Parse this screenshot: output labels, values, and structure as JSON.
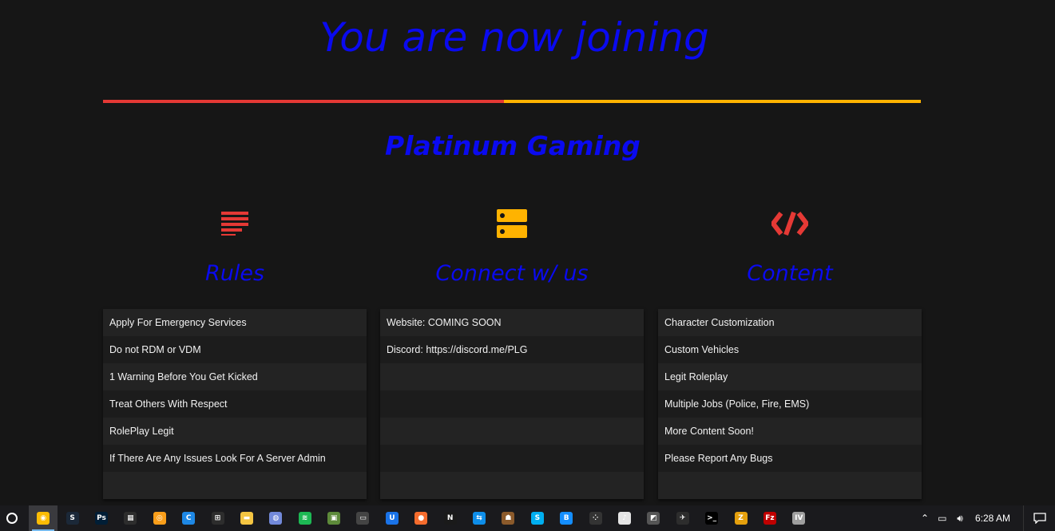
{
  "header": {
    "headline": "You are now joining",
    "server_name": "Platinum Gaming",
    "loading_progress_fraction": 0.49,
    "progress_colors": {
      "fill": "#e53935",
      "track": "#ffb300"
    }
  },
  "columns": [
    {
      "title": "Rules",
      "icon": "align-left-icon",
      "icon_color": "#e53935",
      "items": [
        "Apply For Emergency Services",
        "Do not RDM or VDM",
        "1 Warning Before You Get Kicked",
        "Treat Others With Respect",
        "RolePlay Legit",
        "If There Are Any Issues Look For A Server Admin",
        ""
      ]
    },
    {
      "title": "Connect w/ us",
      "icon": "server-icon",
      "icon_color": "#ffb300",
      "items": [
        "Website: COMING SOON",
        "Discord: https://discord.me/PLG",
        "",
        "",
        "",
        "",
        ""
      ]
    },
    {
      "title": "Content",
      "icon": "code-icon",
      "icon_color": "#e53935",
      "items": [
        "Character Customization",
        "Custom Vehicles",
        "Legit Roleplay",
        "Multiple Jobs (Police, Fire, EMS)",
        "More Content Soon!",
        "Please Report Any Bugs",
        ""
      ]
    }
  ],
  "taskbar": {
    "apps": [
      {
        "name": "chrome-icon",
        "active": true,
        "color": "#fbbc05",
        "glyph": "◉"
      },
      {
        "name": "steam-icon",
        "color": "#1b2838",
        "glyph": "S"
      },
      {
        "name": "photoshop-icon",
        "color": "#001e36",
        "glyph": "Ps"
      },
      {
        "name": "video-editor-icon",
        "color": "#2d2d2d",
        "glyph": "▦"
      },
      {
        "name": "overwatch-icon",
        "color": "#f99e1a",
        "glyph": "◎"
      },
      {
        "name": "ccleaner-icon",
        "color": "#1e88e5",
        "glyph": "C"
      },
      {
        "name": "store-icon",
        "color": "#2d2d2d",
        "glyph": "⊞"
      },
      {
        "name": "file-explorer-icon",
        "color": "#f4c542",
        "glyph": "▬"
      },
      {
        "name": "discord-icon",
        "color": "#7289da",
        "glyph": "◍"
      },
      {
        "name": "spotify-icon",
        "color": "#1db954",
        "glyph": "≋"
      },
      {
        "name": "minecraft-icon",
        "color": "#5d8a3a",
        "glyph": "▣"
      },
      {
        "name": "car-game-icon",
        "color": "#444444",
        "glyph": "▭"
      },
      {
        "name": "uplay-icon",
        "color": "#1a73e8",
        "glyph": "U"
      },
      {
        "name": "origin-icon",
        "color": "#f56c2d",
        "glyph": "●"
      },
      {
        "name": "netflix-icon",
        "color": "#1a1a1a",
        "glyph": "N"
      },
      {
        "name": "teamviewer-icon",
        "color": "#0e8ee9",
        "glyph": "⇆"
      },
      {
        "name": "game-character-icon",
        "color": "#8b5a2b",
        "glyph": "☗"
      },
      {
        "name": "skype-icon",
        "color": "#00aff0",
        "glyph": "S"
      },
      {
        "name": "battlenet-icon",
        "color": "#148eff",
        "glyph": "B"
      },
      {
        "name": "dots-app-icon",
        "color": "#333333",
        "glyph": "⁘"
      },
      {
        "name": "itunes-icon",
        "color": "#e5e5e5",
        "glyph": "♪"
      },
      {
        "name": "snipping-tool-icon",
        "color": "#555555",
        "glyph": "◩"
      },
      {
        "name": "airplane-app-icon",
        "color": "#2d2d2d",
        "glyph": "✈"
      },
      {
        "name": "terminal-icon",
        "color": "#000000",
        "glyph": ">_"
      },
      {
        "name": "plex-icon",
        "color": "#e5a00d",
        "glyph": "Z"
      },
      {
        "name": "filezilla-icon",
        "color": "#bf0000",
        "glyph": "Fz"
      },
      {
        "name": "iv-app-icon",
        "color": "#9e9e9e",
        "glyph": "IV"
      }
    ],
    "clock": "6:28 AM"
  }
}
